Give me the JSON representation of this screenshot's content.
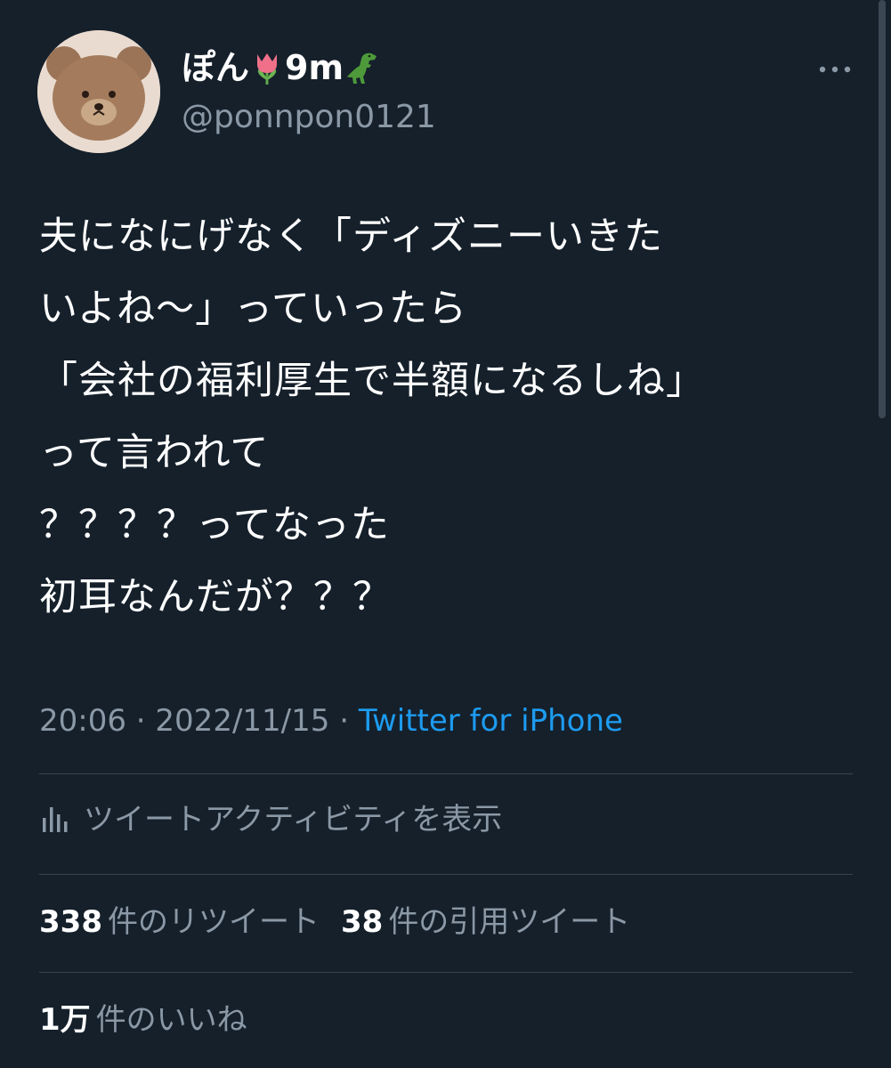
{
  "user": {
    "name": "ぽん",
    "name_suffix": "9m",
    "name_emojis": [
      "tulip-icon",
      "t-rex-icon"
    ],
    "handle": "@ponnpon0121"
  },
  "tweet": {
    "lines": [
      "夫になにげなく「ディズニーいきた",
      "いよね〜」っていったら",
      "「会社の福利厚生で半額になるしね」",
      "って言われて",
      "？？？？ってなった",
      "初耳なんだが？？？"
    ]
  },
  "meta": {
    "time": "20:06",
    "separator": "·",
    "date": "2022/11/15",
    "source": "Twitter for iPhone"
  },
  "activity": {
    "label": "ツイートアクティビティを表示"
  },
  "stats": {
    "retweets_count": "338",
    "retweets_label": "件のリツイート",
    "quotes_count": "38",
    "quotes_label": "件の引用ツイート",
    "likes_count": "1万",
    "likes_label": "件のいいね"
  },
  "colors": {
    "background": "#15202b",
    "text": "#ffffff",
    "secondary": "#8b98a5",
    "link": "#1d9bf0",
    "divider": "#38444d"
  }
}
